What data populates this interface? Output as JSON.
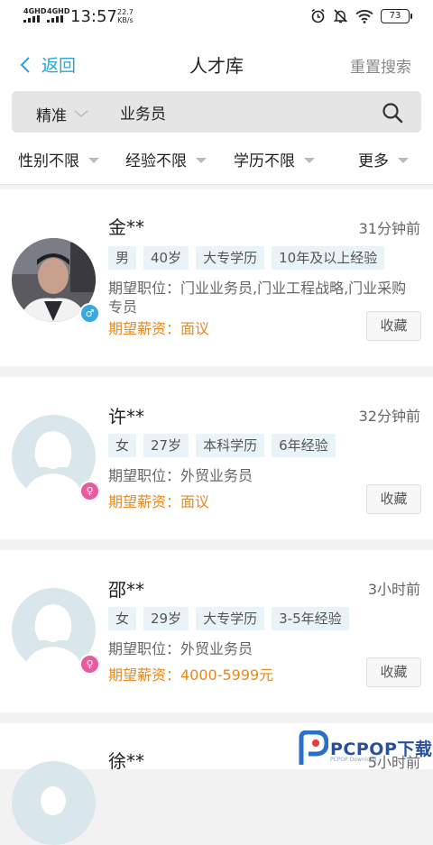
{
  "status_bar": {
    "signal1": "4GHD",
    "signal2": "4GHD",
    "time": "13:57",
    "speed_value": "22.7",
    "speed_unit": "KB/s",
    "battery": "73"
  },
  "header": {
    "back_label": "返回",
    "title": "人才库",
    "reset_label": "重置搜索"
  },
  "search": {
    "mode": "精准",
    "value": "业务员",
    "placeholder": ""
  },
  "filters": [
    "性别不限",
    "经验不限",
    "学历不限",
    "更多"
  ],
  "candidates": [
    {
      "name": "金**",
      "time_ago": "31分钟前",
      "gender": "male",
      "tags": [
        "男",
        "40岁",
        "大专学历",
        "10年及以上经验"
      ],
      "position": "期望职位：门业业务员,门业工程战略,门业采购专员",
      "salary": "期望薪资：面议",
      "fav_label": "收藏"
    },
    {
      "name": "许**",
      "time_ago": "32分钟前",
      "gender": "female",
      "tags": [
        "女",
        "27岁",
        "本科学历",
        "6年经验"
      ],
      "position": "期望职位：外贸业务员",
      "salary": "期望薪资：面议",
      "fav_label": "收藏"
    },
    {
      "name": "邵**",
      "time_ago": "3小时前",
      "gender": "female",
      "tags": [
        "女",
        "29岁",
        "大专学历",
        "3-5年经验"
      ],
      "position": "期望职位：外贸业务员",
      "salary": "期望薪资：4000-5999元",
      "fav_label": "收藏"
    },
    {
      "name": "徐**",
      "time_ago": "5小时前",
      "gender": "female",
      "tags": [],
      "position": "",
      "salary": "",
      "fav_label": ""
    }
  ],
  "watermark": {
    "text": "PCPOP下载",
    "sub": "PCPOP Download"
  },
  "colors": {
    "accent": "#2aa5d9",
    "salary": "#e8891d",
    "tag_bg": "#e8f4f8",
    "male": "#3aa8e0",
    "female": "#e85b9e"
  }
}
